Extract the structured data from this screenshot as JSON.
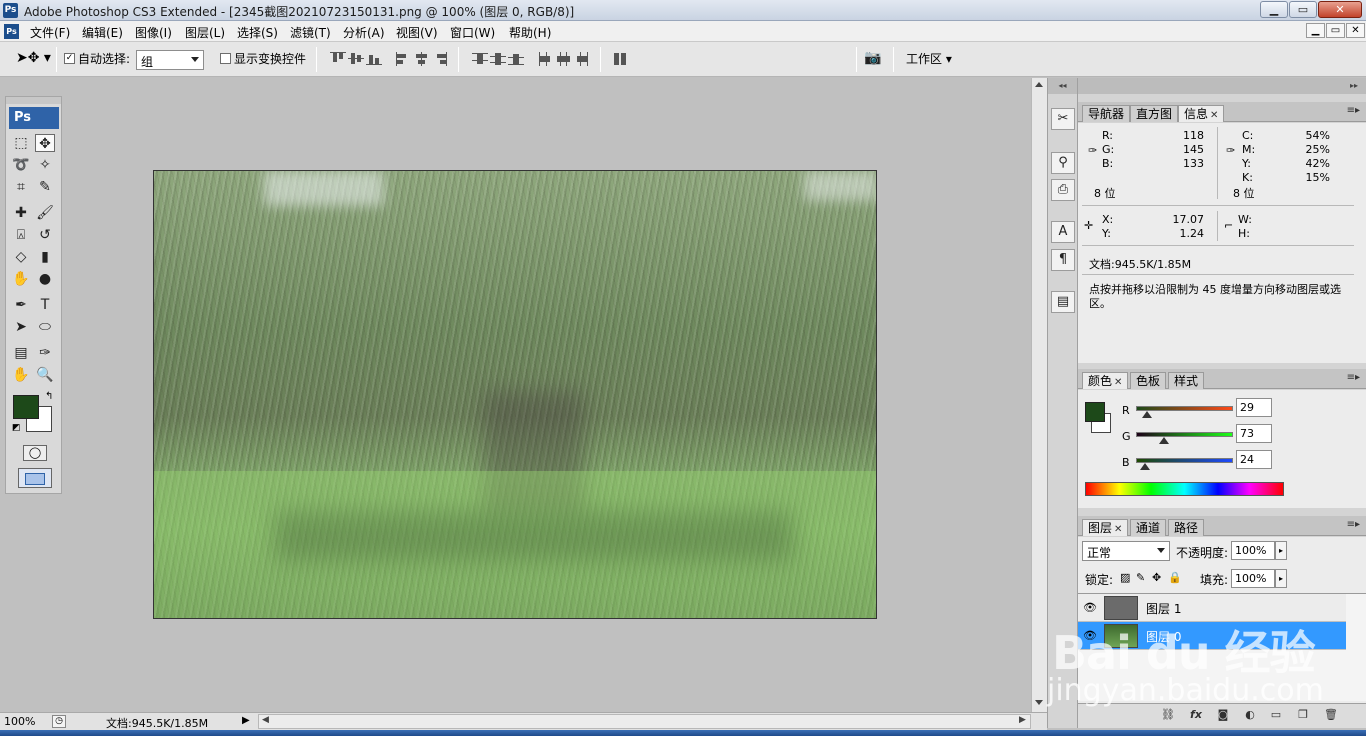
{
  "window": {
    "app_icon": "Ps",
    "title": "Adobe Photoshop CS3 Extended - [2345截图20210723150131.png @ 100% (图层 0, RGB/8)]",
    "buttons": [
      "▁",
      "▭",
      "✕"
    ]
  },
  "menubar": {
    "app_icon": "Ps",
    "items": [
      "文件(F)",
      "编辑(E)",
      "图像(I)",
      "图层(L)",
      "选择(S)",
      "滤镜(T)",
      "分析(A)",
      "视图(V)",
      "窗口(W)",
      "帮助(H)"
    ],
    "doc_buttons": [
      "▁",
      "▭",
      "✕"
    ]
  },
  "options_bar": {
    "auto_select_label": "自动选择:",
    "auto_select_checked": true,
    "group_value": "组",
    "show_transform_label": "显示变换控件",
    "show_transform_checked": false,
    "workspace_label": "工作区"
  },
  "toolbox": {
    "logo": "Ps",
    "foreground_color": "#1d4919",
    "background_color": "#ffffff"
  },
  "status_bar": {
    "zoom": "100%",
    "doc_info": "文档:945.5K/1.85M"
  },
  "info_panel": {
    "tabs": [
      "导航器",
      "直方图",
      "信息"
    ],
    "active_tab": "信息",
    "rgb": {
      "R_label": "R:",
      "R": "118",
      "G_label": "G:",
      "G": "145",
      "B_label": "B:",
      "B": "133"
    },
    "cmyk": {
      "C_label": "C:",
      "C": "54%",
      "M_label": "M:",
      "M": "25%",
      "Y_label": "Y:",
      "Y": "42%",
      "K_label": "K:",
      "K": "15%"
    },
    "bit_depth_left": "8 位",
    "bit_depth_right": "8 位",
    "pos": {
      "X_label": "X:",
      "X": "17.07",
      "Y_label": "Y:",
      "Y": "1.24"
    },
    "size": {
      "W_label": "W:",
      "H_label": "H:"
    },
    "doc_info": "文档:945.5K/1.85M",
    "hint": "点按并拖移以沿限制为 45 度增量方向移动图层或选区。"
  },
  "color_panel": {
    "tabs": [
      "颜色",
      "色板",
      "样式"
    ],
    "active_tab": "颜色",
    "channels": [
      {
        "label": "R",
        "value": "29"
      },
      {
        "label": "G",
        "value": "73"
      },
      {
        "label": "B",
        "value": "24"
      }
    ],
    "channel_values": [
      29,
      73,
      24
    ],
    "swatch": "#1d4919"
  },
  "layers_panel": {
    "tabs": [
      "图层",
      "通道",
      "路径"
    ],
    "active_tab": "图层",
    "blend_mode": "正常",
    "opacity_label": "不透明度:",
    "opacity": "100%",
    "lock_label": "锁定:",
    "fill_label": "填充:",
    "fill": "100%",
    "layers": [
      {
        "name": "图层 1",
        "selected": false
      },
      {
        "name": "图层 0",
        "selected": true
      }
    ],
    "footer_icons": [
      "link-icon",
      "fx-icon",
      "mask-icon",
      "adjustment-icon",
      "folder-icon",
      "new-layer-icon",
      "trash-icon"
    ]
  },
  "watermark": {
    "logo": "Bai du 经验",
    "site": "jingyan.baidu.com"
  }
}
